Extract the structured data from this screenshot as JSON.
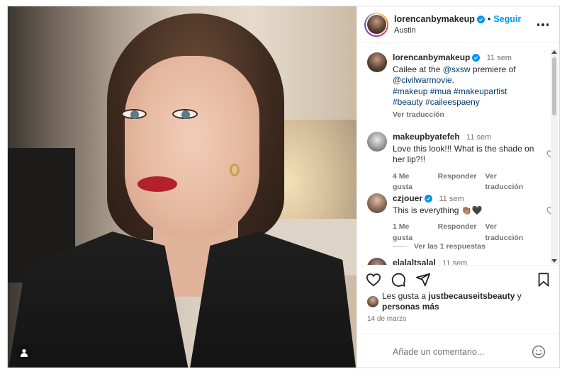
{
  "post": {
    "author": "lorencanbymakeup",
    "follow_label": "Seguir",
    "location": "Austin",
    "separator": "•"
  },
  "caption": {
    "username": "lorencanbymakeup",
    "time": "11 sem",
    "text_1": "Cailee at the ",
    "mention_1": "@sxsw",
    "text_2": " premiere of ",
    "mention_2": "@civilwarmovie",
    "text_3": ".",
    "hashtags": "#makeup #mua #makeupartist #beauty #caileespaeny",
    "translate": "Ver traducción"
  },
  "comments": [
    {
      "username": "makeupbyatefeh",
      "time": "11 sem",
      "text": "Love this look!!! What is the shade on her lip?!!",
      "likes": "4 Me gusta",
      "reply": "Responder",
      "translate": "Ver traducción"
    },
    {
      "username": "czjouer",
      "time": "11 sem",
      "text": "This is everything 👏🏽🖤",
      "likes": "1 Me gusta",
      "reply": "Responder",
      "translate": "Ver traducción",
      "view_replies": "Ver las 1 respuestas"
    },
    {
      "username": "elalaltsalal",
      "time": "11 sem"
    }
  ],
  "likes_line": {
    "prefix": "Les gusta a ",
    "user": "justbecauseitsbeauty",
    "middle": " y ",
    "others": "personas más"
  },
  "date": "14 de marzo",
  "comment_input": {
    "placeholder": "Añade un comentario..."
  },
  "colors": {
    "accent": "#0095f6",
    "link": "#00376b",
    "muted": "#737373"
  },
  "icons": [
    "heart-icon",
    "comment-icon",
    "share-icon",
    "bookmark-icon",
    "emoji-icon",
    "more-icon",
    "verified-badge-icon",
    "user-tag-icon"
  ]
}
